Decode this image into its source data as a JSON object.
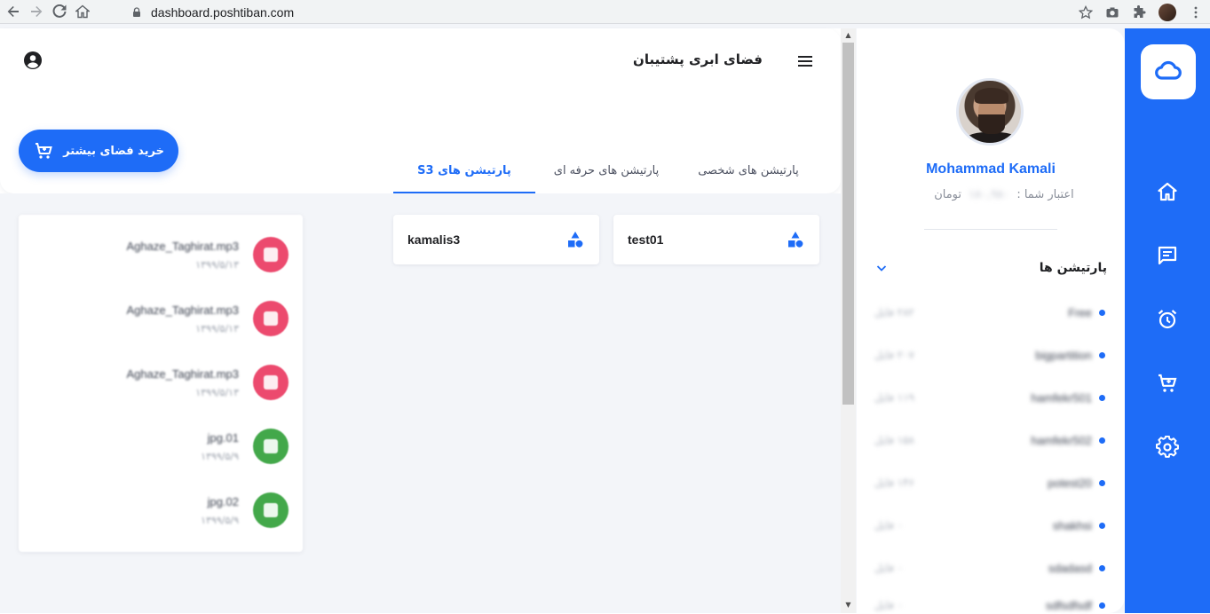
{
  "browser": {
    "url": "dashboard.poshtiban.com"
  },
  "header": {
    "title": "فضای ابری پشتیبان",
    "buy_button_label": "خرید فضای بیشتر"
  },
  "tabs": [
    {
      "label": "پارتیشن های شخصی",
      "active": false
    },
    {
      "label": "پارتیشن های حرفه ای",
      "active": false
    },
    {
      "label": "پارتیشن های S3",
      "active": true
    }
  ],
  "partitions_cards": [
    {
      "name": "test01",
      "icon": "shapes-icon"
    },
    {
      "name": "kamalis3",
      "icon": "shapes-icon"
    }
  ],
  "recent_files": [
    {
      "name": "Aghaze_Taghirat.mp3",
      "date": "۱۳۹۹/۵/۱۳",
      "icon": "audio-file-icon",
      "color": "#ec4a6e"
    },
    {
      "name": "Aghaze_Taghirat.mp3",
      "date": "۱۳۹۹/۵/۱۳",
      "icon": "audio-file-icon",
      "color": "#ec4a6e"
    },
    {
      "name": "Aghaze_Taghirat.mp3",
      "date": "۱۳۹۹/۵/۱۳",
      "icon": "audio-file-icon",
      "color": "#ec4a6e"
    },
    {
      "name": "jpg.01",
      "date": "۱۳۹۹/۵/۹",
      "icon": "image-file-icon",
      "color": "#43a84a"
    },
    {
      "name": "jpg.02",
      "date": "۱۳۹۹/۵/۹",
      "icon": "image-file-icon",
      "color": "#43a84a"
    }
  ],
  "profile": {
    "name": "Mohammad Kamali",
    "credit_label": "اعتبار شما :",
    "credit_value": "۱۸۰,۹۸۰",
    "credit_unit": "تومان"
  },
  "sidebar_partitions": {
    "title": "پارتیشن ها",
    "items": [
      {
        "name": "Free",
        "size": "۲۸۲ فایل"
      },
      {
        "name": "bigpartition",
        "size": "۲۰۷ فایل"
      },
      {
        "name": "hamfekr501",
        "size": "۱۱۹ فایل"
      },
      {
        "name": "hamfekr502",
        "size": "۱۵۸ فایل"
      },
      {
        "name": "potest20",
        "size": "۱۴۶ فایل"
      },
      {
        "name": "shakhsi",
        "size": "۰ فایل"
      },
      {
        "name": "sdadasd",
        "size": "۰ فایل"
      },
      {
        "name": "sdfsdfsdf",
        "size": "۰ فایل"
      }
    ]
  },
  "colors": {
    "primary": "#1e6cf7",
    "background": "#f3f5f9",
    "audio": "#ec4a6e",
    "image": "#43a84a"
  }
}
